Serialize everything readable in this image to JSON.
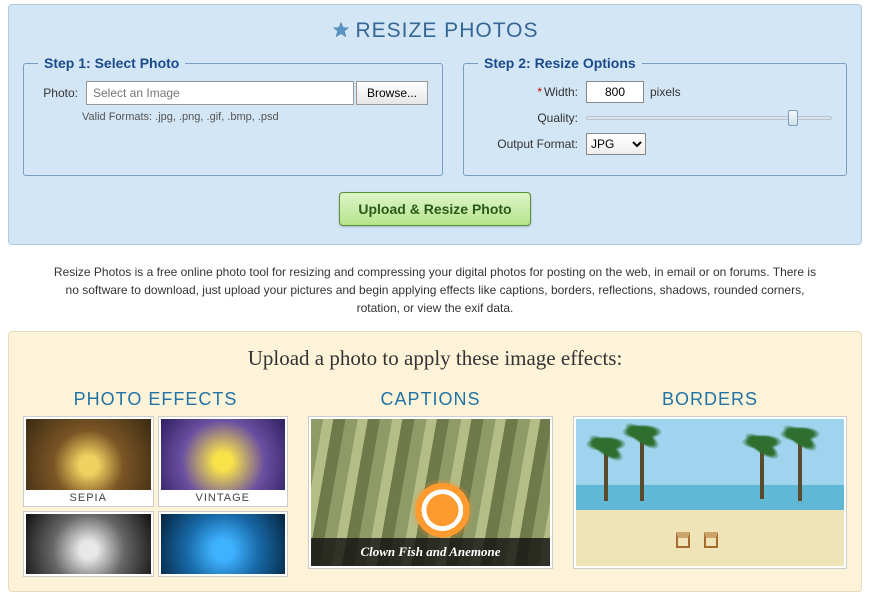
{
  "site_title": "RESIZE PHOTOS",
  "step1": {
    "legend": "Step 1: Select Photo",
    "photo_label": "Photo:",
    "placeholder": "Select an Image",
    "browse": "Browse...",
    "hint": "Valid Formats: .jpg, .png, .gif, .bmp, .psd"
  },
  "step2": {
    "legend": "Step 2: Resize Options",
    "width_label": "Width:",
    "width_value": "800",
    "pixels": "pixels",
    "quality_label": "Quality:",
    "quality_percent": 82,
    "format_label": "Output Format:",
    "format_value": "JPG"
  },
  "main_button": "Upload & Resize Photo",
  "description": "Resize Photos is a free online photo tool for resizing and compressing your digital photos for posting on the web, in email or on forums. There is no software to download, just upload your pictures and begin applying effects like captions, borders, reflections, shadows, rounded corners, rotation, or view the exif data.",
  "effects": {
    "heading": "Upload a photo to apply these image effects:",
    "col1_title": "PHOTO EFFECTS",
    "col2_title": "CAPTIONS",
    "col3_title": "BORDERS",
    "thumbs": [
      {
        "label": "SEPIA"
      },
      {
        "label": "VINTAGE"
      },
      {
        "label": ""
      },
      {
        "label": ""
      }
    ],
    "caption_example": "Clown Fish and Anemone"
  }
}
